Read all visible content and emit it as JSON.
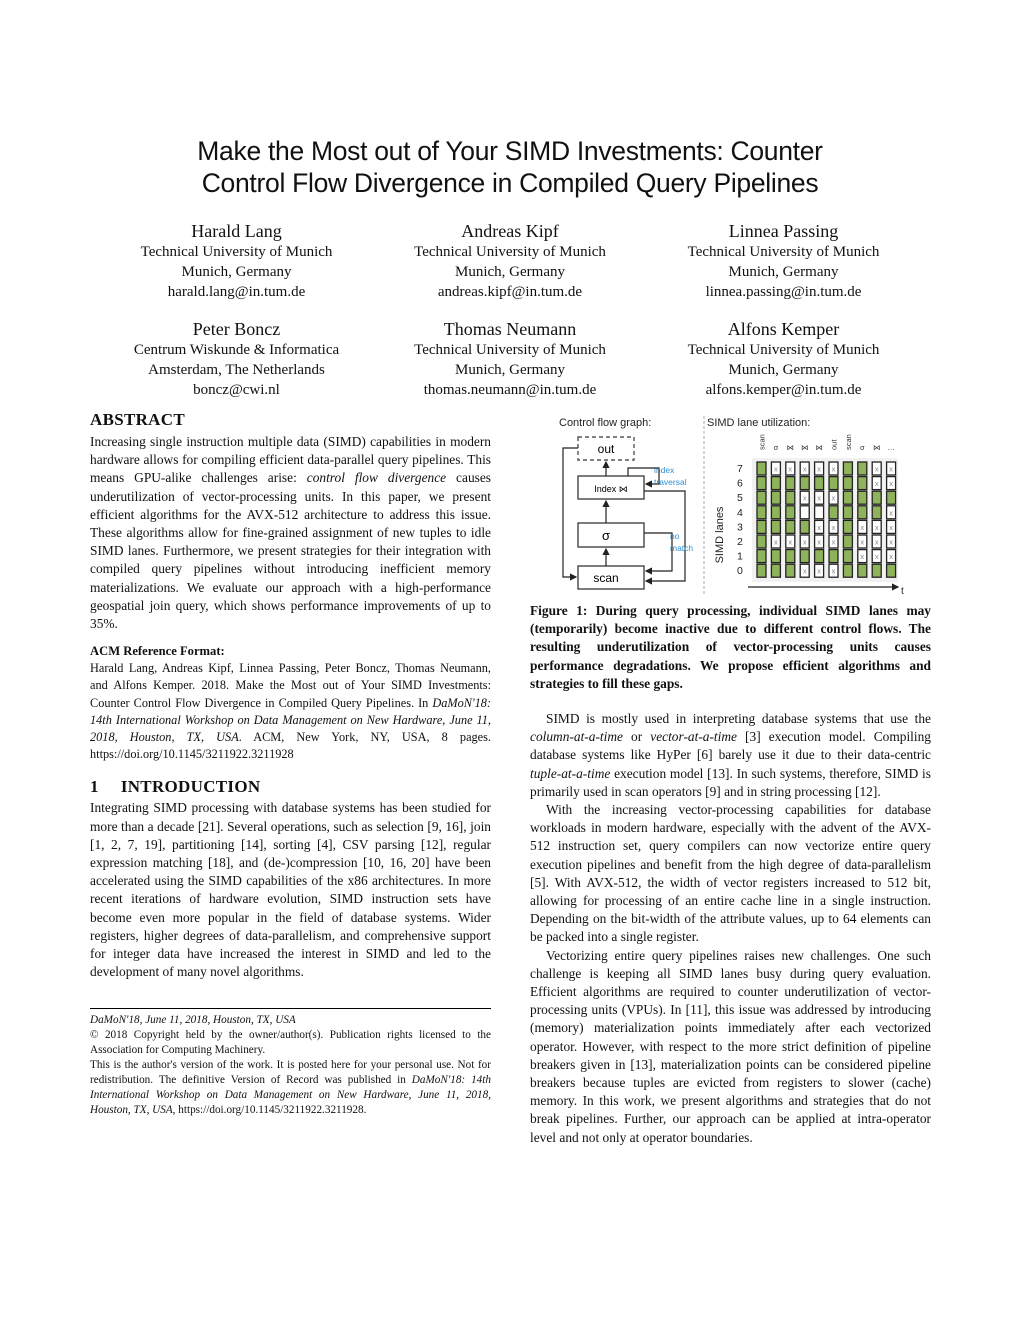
{
  "title": {
    "line1": "Make the Most out of Your SIMD Investments: Counter",
    "line2": "Control Flow Divergence in Compiled Query Pipelines"
  },
  "authors": [
    {
      "name": "Harald Lang",
      "affiliation": "Technical University of Munich",
      "location": "Munich, Germany",
      "email": "harald.lang@in.tum.de"
    },
    {
      "name": "Andreas Kipf",
      "affiliation": "Technical University of Munich",
      "location": "Munich, Germany",
      "email": "andreas.kipf@in.tum.de"
    },
    {
      "name": "Linnea Passing",
      "affiliation": "Technical University of Munich",
      "location": "Munich, Germany",
      "email": "linnea.passing@in.tum.de"
    },
    {
      "name": "Peter Boncz",
      "affiliation": "Centrum Wiskunde & Informatica",
      "location": "Amsterdam, The Netherlands",
      "email": "boncz@cwi.nl"
    },
    {
      "name": "Thomas Neumann",
      "affiliation": "Technical University of Munich",
      "location": "Munich, Germany",
      "email": "thomas.neumann@in.tum.de"
    },
    {
      "name": "Alfons Kemper",
      "affiliation": "Technical University of Munich",
      "location": "Munich, Germany",
      "email": "alfons.kemper@in.tum.de"
    }
  ],
  "abstract": {
    "heading": "ABSTRACT",
    "text_a": "Increasing single instruction multiple data (SIMD) capabilities in modern hardware allows for compiling efficient data-parallel query pipelines. This means GPU-alike challenges arise: ",
    "text_italic": "control flow divergence",
    "text_b": " causes underutilization of vector-processing units. In this paper, we present efficient algorithms for the AVX-512 architecture to address this issue. These algorithms allow for fine-grained assignment of new tuples to idle SIMD lanes. Furthermore, we present strategies for their integration with compiled query pipelines without introducing inefficient memory materializations. We evaluate our approach with a high-performance geospatial join query, which shows performance improvements of up to 35%."
  },
  "acm_reference": {
    "heading": "ACM Reference Format:",
    "text_a": "Harald Lang, Andreas Kipf, Linnea Passing, Peter Boncz, Thomas Neumann, and Alfons Kemper. 2018. Make the Most out of Your SIMD Investments: Counter Control Flow Divergence in Compiled Query Pipelines. In ",
    "text_italic": "DaMoN'18: 14th International Workshop on Data Management on New Hardware, June 11, 2018, Houston, TX, USA",
    "text_b": ". ACM, New York, NY, USA, 8 pages. https://doi.org/10.1145/3211922.3211928"
  },
  "introduction": {
    "number": "1",
    "heading": "INTRODUCTION",
    "paragraph1": "Integrating SIMD processing with database systems has been studied for more than a decade [21]. Several operations, such as selection [9, 16], join [1, 2, 7, 19], partitioning [14], sorting [4], CSV parsing [12], regular expression matching [18], and (de-)compression [10, 16, 20] have been accelerated using the SIMD capabilities of the x86 architectures. In more recent iterations of hardware evolution, SIMD instruction sets have become even more popular in the field of database systems. Wider registers, higher degrees of data-parallelism, and comprehensive support for integer data have increased the interest in SIMD and led to the development of many novel algorithms.",
    "p2_a": "SIMD is mostly used in interpreting database systems that use the ",
    "p2_i1": "column-at-a-time",
    "p2_b": " or ",
    "p2_i2": "vector-at-a-time",
    "p2_c": " [3] execution model. Compiling database systems like HyPer [6] barely use it due to their data-centric ",
    "p2_i3": "tuple-at-a-time",
    "p2_d": " execution model [13]. In such systems, therefore, SIMD is primarily used in scan operators [9] and in string processing [12].",
    "paragraph3": "With the increasing vector-processing capabilities for database workloads in modern hardware, especially with the advent of the AVX-512 instruction set, query compilers can now vectorize entire query execution pipelines and benefit from the high degree of data-parallelism [5]. With AVX-512, the width of vector registers increased to 512 bit, allowing for processing of an entire cache line in a single instruction. Depending on the bit-width of the attribute values, up to 64 elements can be packed into a single register.",
    "paragraph4": "Vectorizing entire query pipelines raises new challenges. One such challenge is keeping all SIMD lanes busy during query evaluation. Efficient algorithms are required to counter underutilization of vector-processing units (VPUs). In [11], this issue was addressed by introducing (memory) materialization points immediately after each vectorized operator. However, with respect to the more strict definition of pipeline breakers given in [13], materialization points can be considered pipeline breakers because tuples are evicted from registers to slower (cache) memory. In this work, we present algorithms and strategies that do not break pipelines. Further, our approach can be applied at intra-operator level and not only at operator boundaries."
  },
  "footnote": {
    "venue": "DaMoN'18, June 11, 2018, Houston, TX, USA",
    "copyright": "© 2018 Copyright held by the owner/author(s). Publication rights licensed to the Association for Computing Machinery.",
    "version_a": "This is the author's version of the work. It is posted here for your personal use. Not for redistribution. The definitive Version of Record was published in ",
    "version_italic": "DaMoN'18: 14th International Workshop on Data Management on New Hardware, June 11, 2018, Houston, TX, USA",
    "version_b": ", https://doi.org/10.1145/3211922.3211928."
  },
  "figure": {
    "caption": "Figure 1: During query processing, individual SIMD lanes may (temporarily) become inactive due to different control flows. The resulting underutilization of vector-processing units causes performance degradations. We propose efficient algorithms and strategies to fill these gaps.",
    "cfg": {
      "title": "Control flow graph:",
      "nodes": {
        "out": "out",
        "index": "Index ⋈",
        "sigma": "σ",
        "scan": "scan"
      },
      "edge_labels": {
        "index_traversal_1": "index",
        "index_traversal_2": "traversal",
        "no_match_1": "no",
        "no_match_2": "match"
      },
      "label_color": "#2e8fd3"
    },
    "lanes": {
      "title": "SIMD lane utilization:",
      "ylabel": "SIMD lanes",
      "xlabel": "t",
      "lane_labels": [
        "7",
        "6",
        "5",
        "4",
        "3",
        "2",
        "1",
        "0"
      ],
      "column_labels": [
        "scan",
        "σ",
        "⋈",
        "⋈",
        "⋈",
        "out",
        "scan",
        "σ",
        "⋈",
        "…"
      ],
      "active_color": "#8fb35a",
      "legend_note": "g = active lane, x = inactive lane, e = empty lane",
      "columns": [
        [
          "g",
          "g",
          "g",
          "g",
          "g",
          "g",
          "g",
          "g"
        ],
        [
          "x",
          "g",
          "g",
          "g",
          "g",
          "x",
          "g",
          "g"
        ],
        [
          "x",
          "g",
          "g",
          "g",
          "g",
          "x",
          "g",
          "g"
        ],
        [
          "x",
          "g",
          "x",
          "e",
          "g",
          "x",
          "g",
          "x"
        ],
        [
          "x",
          "g",
          "x",
          "e",
          "x",
          "x",
          "g",
          "x"
        ],
        [
          "x",
          "g",
          "x",
          "g",
          "x",
          "x",
          "g",
          "x"
        ],
        [
          "g",
          "g",
          "g",
          "g",
          "g",
          "g",
          "g",
          "g"
        ],
        [
          "g",
          "g",
          "g",
          "g",
          "x",
          "x",
          "x",
          "g"
        ],
        [
          "x",
          "x",
          "g",
          "g",
          "x",
          "x",
          "x",
          "g"
        ],
        [
          "x",
          "x",
          "g",
          "x",
          "x",
          "x",
          "x",
          "g"
        ]
      ]
    }
  }
}
